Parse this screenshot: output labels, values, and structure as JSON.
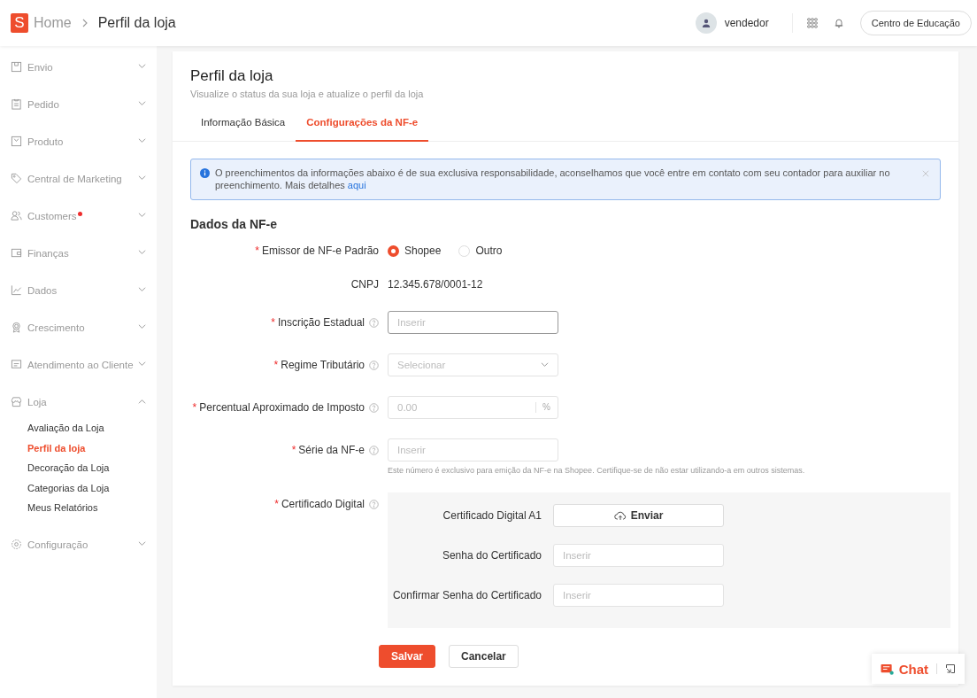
{
  "header": {
    "logo_letter": "S",
    "breadcrumb": [
      {
        "label": "Home",
        "current": false
      },
      {
        "label": "Perfil da loja",
        "current": true
      }
    ],
    "user": "vendedor",
    "education_button": "Centro de Educação"
  },
  "sidebar": {
    "items": [
      {
        "label": "Envio",
        "expanded": false,
        "badge": false
      },
      {
        "label": "Pedido",
        "expanded": false,
        "badge": false
      },
      {
        "label": "Produto",
        "expanded": false,
        "badge": false
      },
      {
        "label": "Central de Marketing",
        "expanded": false,
        "badge": false
      },
      {
        "label": "Customers",
        "expanded": false,
        "badge": true
      },
      {
        "label": "Finanças",
        "expanded": false,
        "badge": false
      },
      {
        "label": "Dados",
        "expanded": false,
        "badge": false
      },
      {
        "label": "Crescimento",
        "expanded": false,
        "badge": false
      },
      {
        "label": "Atendimento ao Cliente",
        "expanded": false,
        "badge": false
      },
      {
        "label": "Loja",
        "expanded": true,
        "badge": false,
        "children": [
          {
            "label": "Avaliação da Loja",
            "selected": false
          },
          {
            "label": "Perfil da loja",
            "selected": true
          },
          {
            "label": "Decoração da Loja",
            "selected": false
          },
          {
            "label": "Categorias da Loja",
            "selected": false
          },
          {
            "label": "Meus Relatórios",
            "selected": false
          }
        ]
      },
      {
        "label": "Configuração",
        "expanded": false,
        "badge": false
      }
    ]
  },
  "page": {
    "title": "Perfil da loja",
    "subtitle": "Visualize o status da sua loja e atualize o perfil da loja",
    "tabs": [
      {
        "label": "Informação Básica",
        "selected": false
      },
      {
        "label": "Configurações da NF-e",
        "selected": true
      }
    ],
    "notice": {
      "text": "O preenchimentos da informações abaixo é de sua exclusiva responsabilidade, aconselhamos que você entre em contato com seu contador para auxiliar no preenchimento. Mais detalhes",
      "link": "aqui"
    },
    "section_title": "Dados da NF-e",
    "fields": [
      {
        "kind": "radio",
        "required_mark": "*",
        "label": "Emissor de NF-e Padrão",
        "help": false,
        "options": [
          {
            "label": "Shopee",
            "selected": true
          },
          {
            "label": "Outro",
            "selected": false
          }
        ]
      },
      {
        "kind": "text",
        "label": "CNPJ",
        "help": false,
        "value": "12.345.678/0001-12"
      },
      {
        "kind": "input",
        "required_mark": "*",
        "label": "Inscrição Estadual",
        "help": true,
        "placeholder": "Inserir",
        "focused": true
      },
      {
        "kind": "select",
        "required_mark": "*",
        "label": "Regime Tributário",
        "help": true,
        "placeholder": "Selecionar"
      },
      {
        "kind": "suffix",
        "required_mark": "*",
        "label": "Percentual Aproximado de Imposto",
        "help": true,
        "placeholder": "0.00",
        "suffix": "%"
      },
      {
        "kind": "input",
        "required_mark": "*",
        "label": "Série da NF-e",
        "help": true,
        "placeholder": "Inserir",
        "focused": false,
        "hint": "Este número é exclusivo para emição da NF-e na Shopee. Certifique-se de não estar utilizando-a em outros sistemas."
      },
      {
        "kind": "certificate",
        "required_mark": "*",
        "label": "Certificado Digital",
        "help": true,
        "rows": [
          {
            "kind": "upload",
            "label": "Certificado Digital A1",
            "button": "Enviar"
          },
          {
            "kind": "input",
            "label": "Senha do Certificado",
            "placeholder": "Inserir"
          },
          {
            "kind": "input",
            "label": "Confirmar Senha do Certificado",
            "placeholder": "Inserir"
          }
        ]
      }
    ],
    "buttons": [
      {
        "label": "Salvar",
        "primary": true
      },
      {
        "label": "Cancelar",
        "primary": false
      }
    ]
  },
  "chat": {
    "label": "Chat"
  }
}
